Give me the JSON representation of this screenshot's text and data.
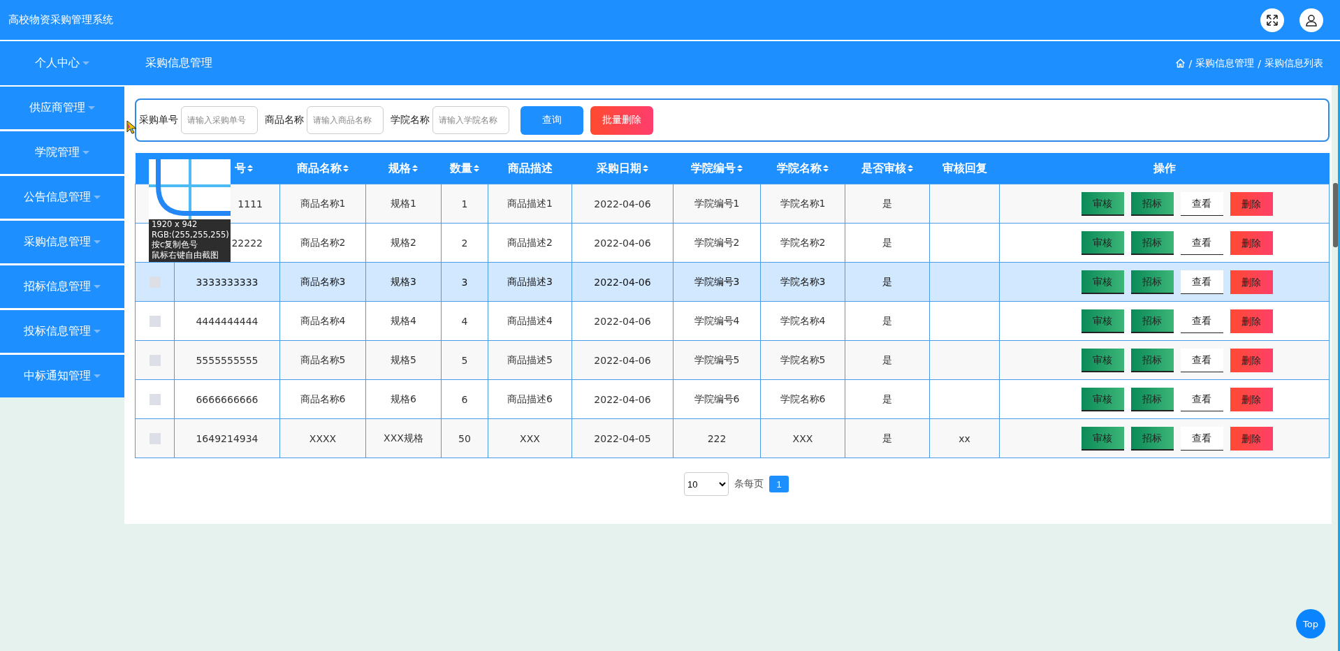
{
  "header": {
    "title": "高校物资采购管理系统"
  },
  "sidebar": {
    "items": [
      {
        "label": "个人中心"
      },
      {
        "label": "供应商管理"
      },
      {
        "label": "学院管理"
      },
      {
        "label": "公告信息管理"
      },
      {
        "label": "采购信息管理"
      },
      {
        "label": "招标信息管理"
      },
      {
        "label": "投标信息管理"
      },
      {
        "label": "中标通知管理"
      }
    ]
  },
  "page_title": "采购信息管理",
  "breadcrumb": [
    {
      "separator": "/",
      "label": "采购信息管理"
    },
    {
      "separator": "/",
      "label": "采购信息列表"
    }
  ],
  "search": {
    "fields": [
      {
        "label": "采购单号",
        "placeholder": "请输入采购单号"
      },
      {
        "label": "商品名称",
        "placeholder": "请输入商品名称"
      },
      {
        "label": "学院名称",
        "placeholder": "请输入学院名称"
      }
    ],
    "buttons": [
      {
        "label": "查询",
        "kind": "primary"
      },
      {
        "label": "批量删除",
        "kind": "danger"
      }
    ]
  },
  "table": {
    "columns": [
      {
        "label": "号",
        "sortable": true,
        "covered": true
      },
      {
        "label": "商品名称",
        "sortable": true
      },
      {
        "label": "规格",
        "sortable": true
      },
      {
        "label": "数量",
        "sortable": true
      },
      {
        "label": "商品描述",
        "sortable": false
      },
      {
        "label": "采购日期",
        "sortable": true
      },
      {
        "label": "学院编号",
        "sortable": true
      },
      {
        "label": "学院名称",
        "sortable": true
      },
      {
        "label": "是否审核",
        "sortable": true
      },
      {
        "label": "审核回复",
        "sortable": false
      },
      {
        "label": "操作",
        "sortable": false
      }
    ],
    "rows": [
      {
        "covered": true,
        "selected": false,
        "cells": [
          "1111",
          "商品名称1",
          "规格1",
          "1",
          "商品描述1",
          "2022-04-06",
          "学院编号1",
          "学院名称1",
          "是",
          null
        ],
        "actions": [
          {
            "label": "审核",
            "kind": "green"
          },
          {
            "label": "招标",
            "kind": "green"
          },
          {
            "label": "查看",
            "kind": "plain"
          },
          {
            "label": "删除",
            "kind": "red"
          }
        ]
      },
      {
        "covered": true,
        "selected": false,
        "cells": [
          "22222",
          "商品名称2",
          "规格2",
          "2",
          "商品描述2",
          "2022-04-06",
          "学院编号2",
          "学院名称2",
          "是",
          null
        ],
        "actions": [
          {
            "label": "审核",
            "kind": "green"
          },
          {
            "label": "招标",
            "kind": "green"
          },
          {
            "label": "查看",
            "kind": "plain"
          },
          {
            "label": "删除",
            "kind": "red"
          }
        ]
      },
      {
        "checked": false,
        "selected": true,
        "cells": [
          "3333333333",
          "商品名称3",
          "规格3",
          "3",
          "商品描述3",
          "2022-04-06",
          "学院编号3",
          "学院名称3",
          "是",
          null
        ],
        "actions": [
          {
            "label": "审核",
            "kind": "green"
          },
          {
            "label": "招标",
            "kind": "green"
          },
          {
            "label": "查看",
            "kind": "plain"
          },
          {
            "label": "删除",
            "kind": "red"
          }
        ]
      },
      {
        "checked": false,
        "selected": false,
        "cells": [
          "4444444444",
          "商品名称4",
          "规格4",
          "4",
          "商品描述4",
          "2022-04-06",
          "学院编号4",
          "学院名称4",
          "是",
          null
        ],
        "actions": [
          {
            "label": "审核",
            "kind": "green"
          },
          {
            "label": "招标",
            "kind": "green"
          },
          {
            "label": "查看",
            "kind": "plain"
          },
          {
            "label": "删除",
            "kind": "red"
          }
        ]
      },
      {
        "checked": false,
        "selected": false,
        "cells": [
          "5555555555",
          "商品名称5",
          "规格5",
          "5",
          "商品描述5",
          "2022-04-06",
          "学院编号5",
          "学院名称5",
          "是",
          null
        ],
        "actions": [
          {
            "label": "审核",
            "kind": "green"
          },
          {
            "label": "招标",
            "kind": "green"
          },
          {
            "label": "查看",
            "kind": "plain"
          },
          {
            "label": "删除",
            "kind": "red"
          }
        ]
      },
      {
        "checked": false,
        "selected": false,
        "cells": [
          "6666666666",
          "商品名称6",
          "规格6",
          "6",
          "商品描述6",
          "2022-04-06",
          "学院编号6",
          "学院名称6",
          "是",
          null
        ],
        "actions": [
          {
            "label": "审核",
            "kind": "green"
          },
          {
            "label": "招标",
            "kind": "green"
          },
          {
            "label": "查看",
            "kind": "plain"
          },
          {
            "label": "删除",
            "kind": "red"
          }
        ]
      },
      {
        "checked": false,
        "selected": false,
        "cells": [
          "1649214934",
          "XXXX",
          "XXX规格",
          "50",
          "XXX",
          "2022-04-05",
          "222",
          "XXX",
          "是",
          "xx"
        ],
        "actions": [
          {
            "label": "审核",
            "kind": "green"
          },
          {
            "label": "招标",
            "kind": "green"
          },
          {
            "label": "查看",
            "kind": "plain"
          },
          {
            "label": "删除",
            "kind": "red"
          }
        ]
      }
    ]
  },
  "pagination": {
    "page_size": "10",
    "page_size_label": "条每页",
    "pages": [
      {
        "label": "1",
        "selected": true
      }
    ]
  },
  "back_to_top": "Top",
  "magnifier": {
    "lines": [
      "1920 x 942",
      "RGB:(255,255,255)",
      "按c复制色号",
      "鼠标右键自由截图"
    ]
  }
}
